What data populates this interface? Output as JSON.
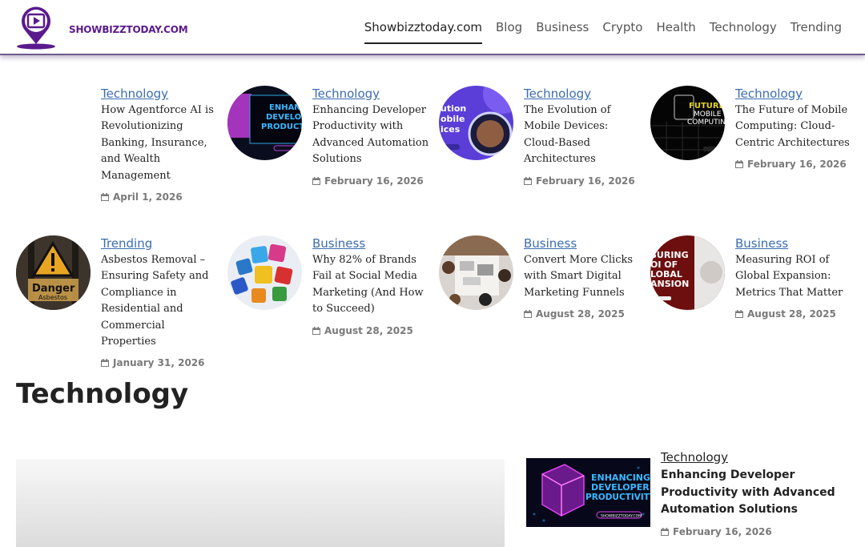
{
  "logo": {
    "text": "SHOWBIZZTODAY.COM",
    "color": "#5a1a8c"
  },
  "nav": [
    {
      "label": "Showbizztoday.com",
      "active": true
    },
    {
      "label": "Blog"
    },
    {
      "label": "Business"
    },
    {
      "label": "Crypto"
    },
    {
      "label": "Health"
    },
    {
      "label": "Technology"
    },
    {
      "label": "Trending"
    }
  ],
  "posts": [
    {
      "category": "Technology",
      "title": "How Agentforce AI is Revolutionizing Banking, Insurance, and Wealth Management",
      "date": "April 1, 2026"
    },
    {
      "category": "Technology",
      "title": "Enhancing Developer Productivity with Advanced Automation Solutions",
      "date": "February 16, 2026"
    },
    {
      "category": "Technology",
      "title": "The Evolution of Mobile Devices: Cloud-Based Architectures",
      "date": "February 16, 2026"
    },
    {
      "category": "Technology",
      "title": "The Future of Mobile Computing: Cloud-Centric Architectures",
      "date": "February 16, 2026"
    },
    {
      "category": "Trending",
      "title": "Asbestos Removal – Ensuring Safety and Compliance in Residential and Commercial Properties",
      "date": "January 31, 2026"
    },
    {
      "category": "Business",
      "title": "Why 82% of Brands Fail at Social Media Marketing (And How to Succeed)",
      "date": "August 28, 2025"
    },
    {
      "category": "Business",
      "title": "Convert More Clicks with Smart Digital Marketing Funnels",
      "date": "August 28, 2025"
    },
    {
      "category": "Business",
      "title": "Measuring ROI of Global Expansion: Metrics That Matter",
      "date": "August 28, 2025"
    }
  ],
  "thumb_texts": {
    "t2": "ENHANCING DEVELOPER PRODUCTIVITY",
    "t3": "Evolution Mobile Devices",
    "t4": "FUTURE MOBILE COMPUTING",
    "t5a": "Danger",
    "t5b": "Asbestos",
    "t8": "MEASURING ROI OF GLOBAL EXPANSION"
  },
  "section": {
    "title": "Technology"
  },
  "feature": {
    "category": "Technology",
    "title": "Enhancing Developer Productivity with Advanced Automation Solutions",
    "date": "February 16, 2026",
    "thumb_text": "ENHANCING DEVELOPER PRODUCTIVITY",
    "thumb_site": "SHOWBIZZTODAY.COM"
  },
  "colors": {
    "link": "#3a6db0",
    "header_border": "#6f5a8c",
    "date": "#7a7a7a"
  }
}
